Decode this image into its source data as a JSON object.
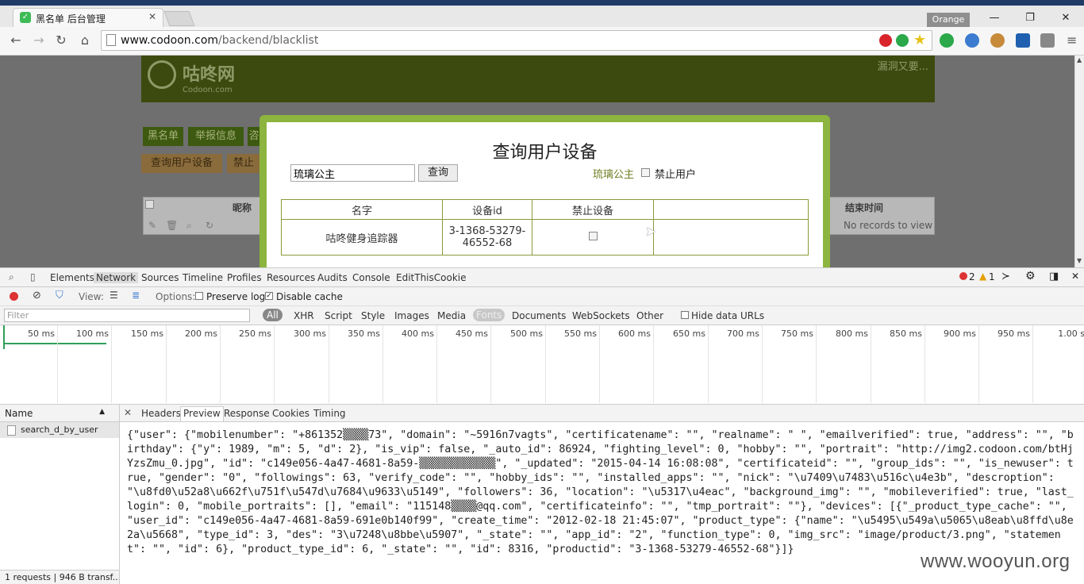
{
  "browser": {
    "tab_title": "黑名单 后台管理",
    "tab_close": "✕",
    "profile_name": "Orange",
    "url_host": "www.codoon.com",
    "url_path": "/backend/blacklist"
  },
  "page": {
    "logo_text": "咕咚网",
    "logo_sub": "Codoon.com",
    "banner_link": "漏洞又要...",
    "nav_row1": [
      "黑名单",
      "举报信息",
      "咨"
    ],
    "nav_row2": [
      "查询用户设备",
      "禁止"
    ],
    "grid_headers": [
      "昵称",
      "结束时间"
    ],
    "grid_empty": "No records to view"
  },
  "modal": {
    "title": "查询用户设备",
    "query_value": "琉璃公主",
    "query_button": "查询",
    "user_name": "琉璃公主",
    "ban_user_label": "禁止用户",
    "table_headers": [
      "名字",
      "设备id",
      "禁止设备",
      ""
    ],
    "rows": [
      {
        "name": "咕咚健身追踪器",
        "device_id_line1": "3-1368-53279-",
        "device_id_line2": "46552-68"
      }
    ]
  },
  "devtools": {
    "tabs": [
      "Elements",
      "Network",
      "Sources",
      "Timeline",
      "Profiles",
      "Resources",
      "Audits",
      "Console",
      "EditThisCookie"
    ],
    "errors": "2",
    "warnings": "1",
    "view_label": "View:",
    "options_label": "Options:",
    "preserve_log": "Preserve log",
    "disable_cache": "Disable cache",
    "filter_placeholder": "Filter",
    "types": [
      "All",
      "XHR",
      "Script",
      "Style",
      "Images",
      "Media",
      "Fonts",
      "Documents",
      "WebSockets",
      "Other"
    ],
    "hide_data_urls": "Hide data URLs",
    "ticks": [
      "50 ms",
      "100 ms",
      "150 ms",
      "200 ms",
      "250 ms",
      "300 ms",
      "350 ms",
      "400 ms",
      "450 ms",
      "500 ms",
      "550 ms",
      "600 ms",
      "650 ms",
      "700 ms",
      "750 ms",
      "800 ms",
      "850 ms",
      "900 ms",
      "950 ms",
      "1.00 s"
    ],
    "name_header": "Name",
    "request_name": "search_d_by_user",
    "status_text": "1 requests | 946 B transf...",
    "preview_tabs": [
      "Headers",
      "Preview",
      "Response",
      "Cookies",
      "Timing"
    ],
    "json_preview": "{\"user\": {\"mobilenumber\": \"+861352▒▒▒▒73\", \"domain\": \"~5916n7vagts\", \"certificatename\": \"\", \"realname\": \" \", \"emailverified\": true, \"address\": \"\", \"birthday\": {\"y\": 1989, \"m\": 5, \"d\": 2}, \"is_vip\": false, \"_auto_id\": 86924, \"fighting_level\": 0, \"hobby\": \"\", \"portrait\": \"http://img2.codoon.com/btHjYzsZmu_0.jpg\", \"id\": \"c149e056-4a47-4681-8a59-▒▒▒▒▒▒▒▒▒▒▒▒\", \"_updated\": \"2015-04-14 16:08:08\", \"certificateid\": \"\", \"group_ids\": \"\", \"is_newuser\": true, \"gender\": \"0\", \"followings\": 63, \"verify_code\": \"\", \"hobby_ids\": \"\", \"installed_apps\": \"\", \"nick\": \"\\u7409\\u7483\\u516c\\u4e3b\", \"descroption\": \"\\u8fd0\\u52a8\\u662f\\u751f\\u547d\\u7684\\u9633\\u5149\", \"followers\": 36, \"location\": \"\\u5317\\u4eac\", \"background_img\": \"\", \"mobileverified\": true, \"last_login\": 0, \"mobile_portraits\": [], \"email\": \"115148▒▒▒▒@qq.com\", \"certificateinfo\": \"\", \"tmp_portrait\": \"\"}, \"devices\": [{\"_product_type_cache\": \"\", \"user_id\": \"c149e056-4a47-4681-8a59-691e0b140f99\", \"create_time\": \"2012-02-18 21:45:07\", \"product_type\": {\"name\": \"\\u5495\\u549a\\u5065\\u8eab\\u8ffd\\u8e2a\\u5668\", \"type_id\": 3, \"des\": \"3\\u7248\\u8bbe\\u5907\", \"_state\": \"\", \"app_id\": \"2\", \"function_type\": 0, \"img_src\": \"image/product/3.png\", \"statement\": \"\", \"id\": 6}, \"product_type_id\": 6, \"_state\": \"\", \"id\": 8316, \"productid\": \"3-1368-53279-46552-68\"}]}"
  },
  "watermark": "www.wooyun.org",
  "colors": {
    "accent_green": "#8cb43e",
    "banner_bg": "#3d4a0f",
    "user_link": "#6e7f22"
  }
}
